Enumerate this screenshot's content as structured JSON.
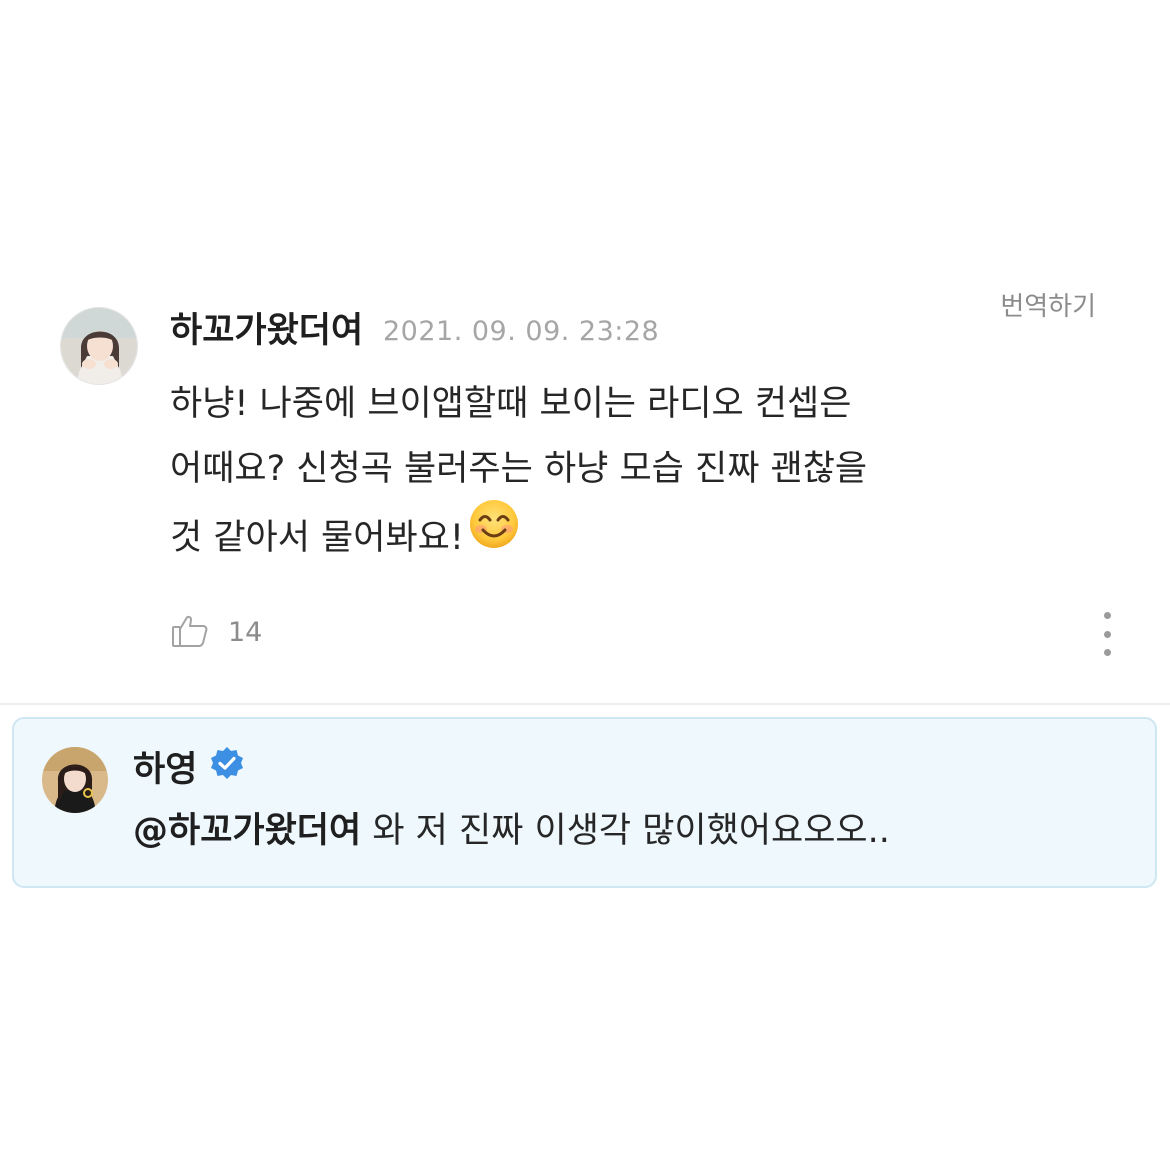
{
  "comment": {
    "author": "하꼬가왔더여",
    "timestamp": "2021. 09. 09. 23:28",
    "translate_label": "번역하기",
    "body_lines": [
      "하냥! 나중에 브이앱할때 보이는 라디오 컨셉은",
      "어때요? 신청곡 불러주는 하냥 모습 진짜 괜찮을",
      "것 같아서 물어봐요!"
    ],
    "emoji": "smiling-face-emoji",
    "likes": "14",
    "like_icon": "thumbs-up-icon",
    "more_icon": "more-vertical-icon"
  },
  "reply": {
    "author": "하영",
    "verified_icon": "verified-badge-icon",
    "mention": "@하꼬가왔더여",
    "text": " 와 저 진짜 이생각 많이했어요오오.."
  },
  "colors": {
    "reply_background": "#eef8fd",
    "reply_border": "#cfe7f2",
    "verified_blue": "#3d8fe3",
    "muted_text": "#a6a6a6"
  }
}
